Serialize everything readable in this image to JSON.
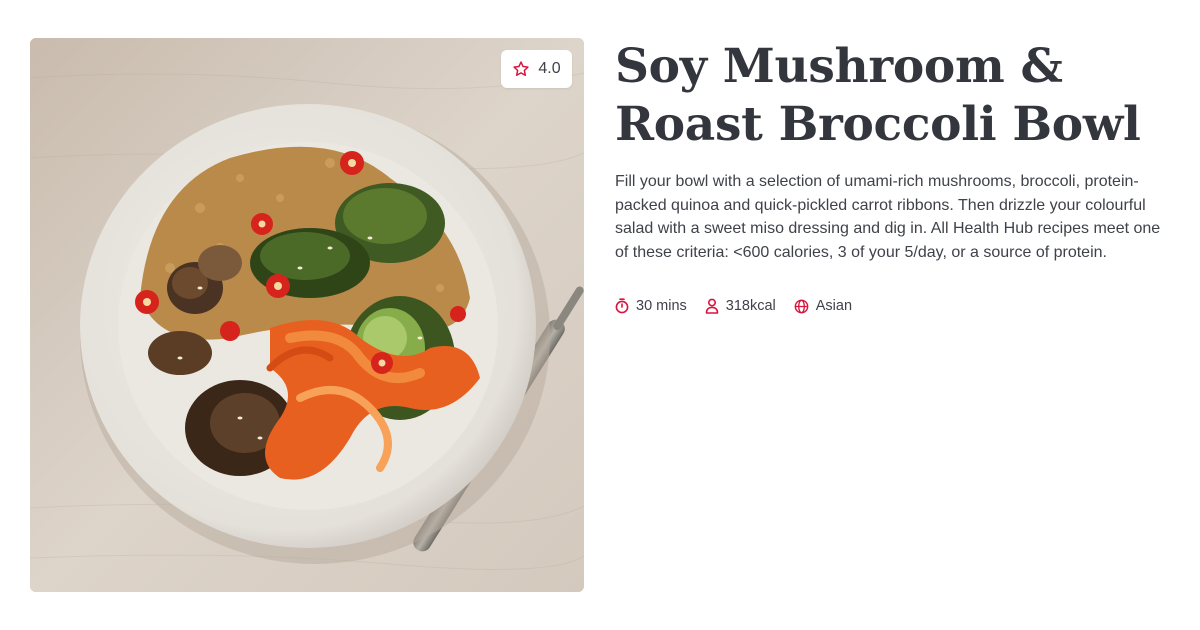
{
  "recipe": {
    "title": "Soy Mushroom & Roast Broccoli Bowl",
    "description": "Fill your bowl with a selection of umami-rich mushrooms, broccoli, protein-packed quinoa and quick-pickled carrot ribbons. Then drizzle your colourful salad with a sweet miso dressing and dig in. All Health Hub recipes meet one of these criteria: <600 calories, 3 of your 5/day, or a source of protein.",
    "rating": "4.0",
    "meta": {
      "time": "30 mins",
      "calories": "318kcal",
      "cuisine": "Asian"
    }
  },
  "icons": {
    "rating": "star-outline-icon",
    "time": "timer-icon",
    "calories": "person-icon",
    "cuisine": "globe-icon"
  },
  "colors": {
    "accent": "#d9143d",
    "text": "#33363d",
    "background": "#ffffff"
  }
}
